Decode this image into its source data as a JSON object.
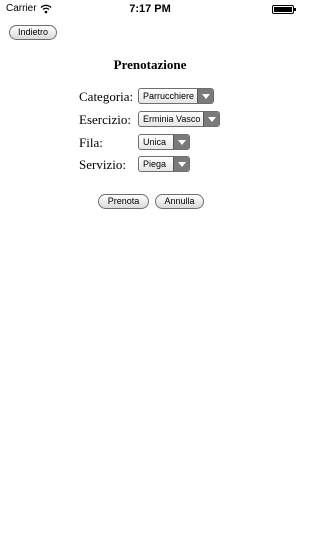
{
  "status_bar": {
    "carrier": "Carrier",
    "time": "7:17 PM"
  },
  "nav": {
    "back_label": "Indietro"
  },
  "page": {
    "title": "Prenotazione"
  },
  "form": {
    "category": {
      "label": "Categoria:",
      "value": "Parrucchiere"
    },
    "business": {
      "label": "Esercizio:",
      "value": "Erminia Vasco"
    },
    "queue": {
      "label": "Fila:",
      "value": "Unica"
    },
    "service": {
      "label": "Servizio:",
      "value": "Piega"
    }
  },
  "actions": {
    "book_label": "Prenota",
    "cancel_label": "Annulla"
  }
}
